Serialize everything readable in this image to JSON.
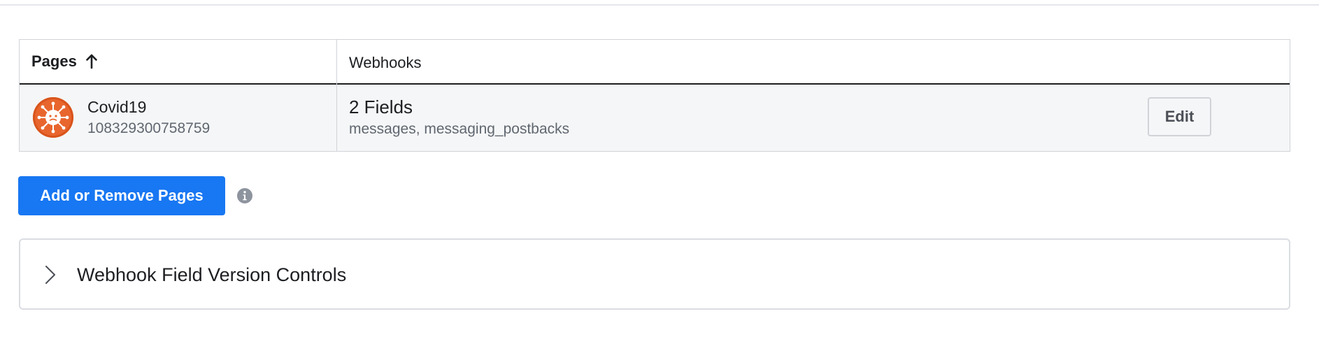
{
  "table": {
    "headers": {
      "pages": "Pages",
      "webhooks": "Webhooks"
    },
    "sort_icon": "arrow-up-icon",
    "rows": [
      {
        "avatar_icon": "virus-icon",
        "avatar_color": "#e8662e",
        "page_name": "Covid19",
        "page_id": "108329300758759",
        "fields_count": "2 Fields",
        "fields_list": "messages, messaging_postbacks",
        "edit_label": "Edit"
      }
    ]
  },
  "actions": {
    "add_remove_label": "Add or Remove Pages",
    "info_icon": "info-icon",
    "accent_color": "#1877f2"
  },
  "version_controls": {
    "title": "Webhook Field Version Controls",
    "icon": "chevron-right-icon"
  }
}
